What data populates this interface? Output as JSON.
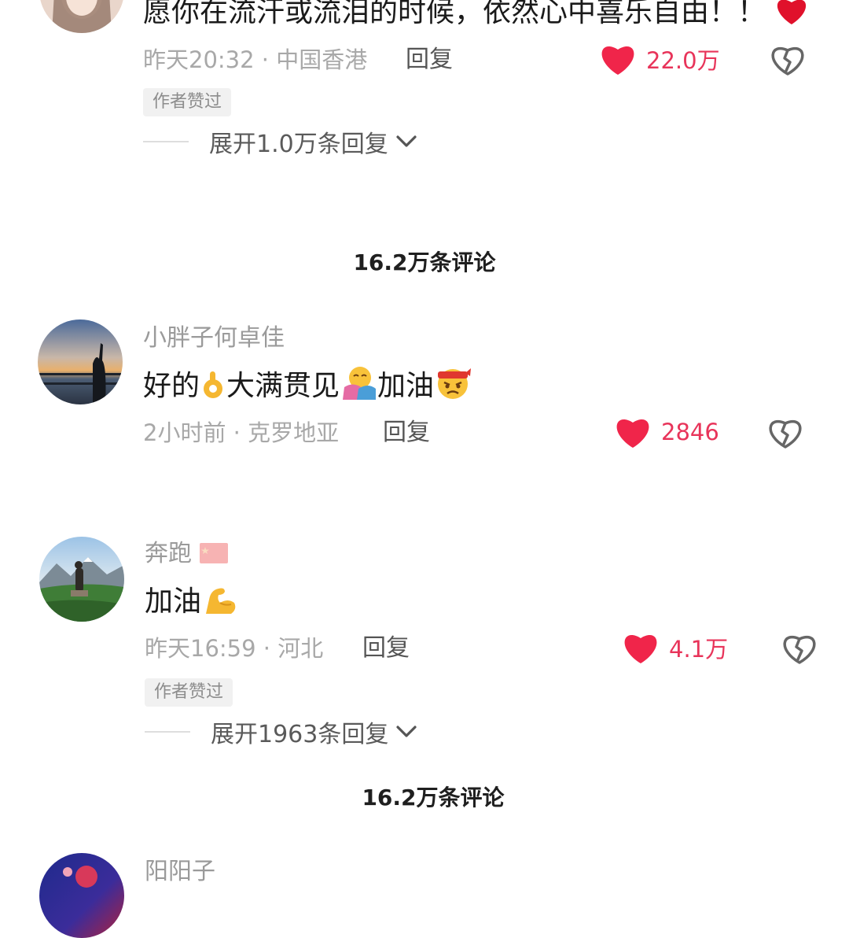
{
  "comments": [
    {
      "username": "",
      "text": "愿你在流汗或流泪的时候，依然心中喜乐自由！！",
      "trailing_emoji": "red-heart",
      "time_location": "昨天20:32 · 中国香港",
      "reply_label": "回复",
      "like_count": "22.0万",
      "author_badge": "作者赞过",
      "expand_label": "展开1.0万条回复"
    },
    {
      "username": "小胖子何卓佳",
      "text_parts": [
        "好的",
        "大满贯见",
        "加油"
      ],
      "emojis": [
        "ok-hand",
        "hugging-face",
        "determined-headband-face"
      ],
      "time_location": "2小时前 · 克罗地亚",
      "reply_label": "回复",
      "like_count": "2846"
    },
    {
      "username": "奔跑",
      "username_flag": "china-flag",
      "text": "加油",
      "emoji": "flexed-biceps",
      "time_location": "昨天16:59 · 河北",
      "reply_label": "回复",
      "like_count": "4.1万",
      "author_badge": "作者赞过",
      "expand_label": "展开1963条回复"
    },
    {
      "username": "阳阳子"
    }
  ],
  "section_titles": [
    "16.2万条评论",
    "16.2万条评论"
  ],
  "colors": {
    "like_red": "#e8345a",
    "meta_grey": "#a8a8a8",
    "username_grey": "#9a9a9a",
    "badge_bg": "#f1f1f1"
  },
  "icons": {
    "like": "heart-icon",
    "dislike": "broken-heart-icon",
    "expand": "chevron-down-icon"
  }
}
